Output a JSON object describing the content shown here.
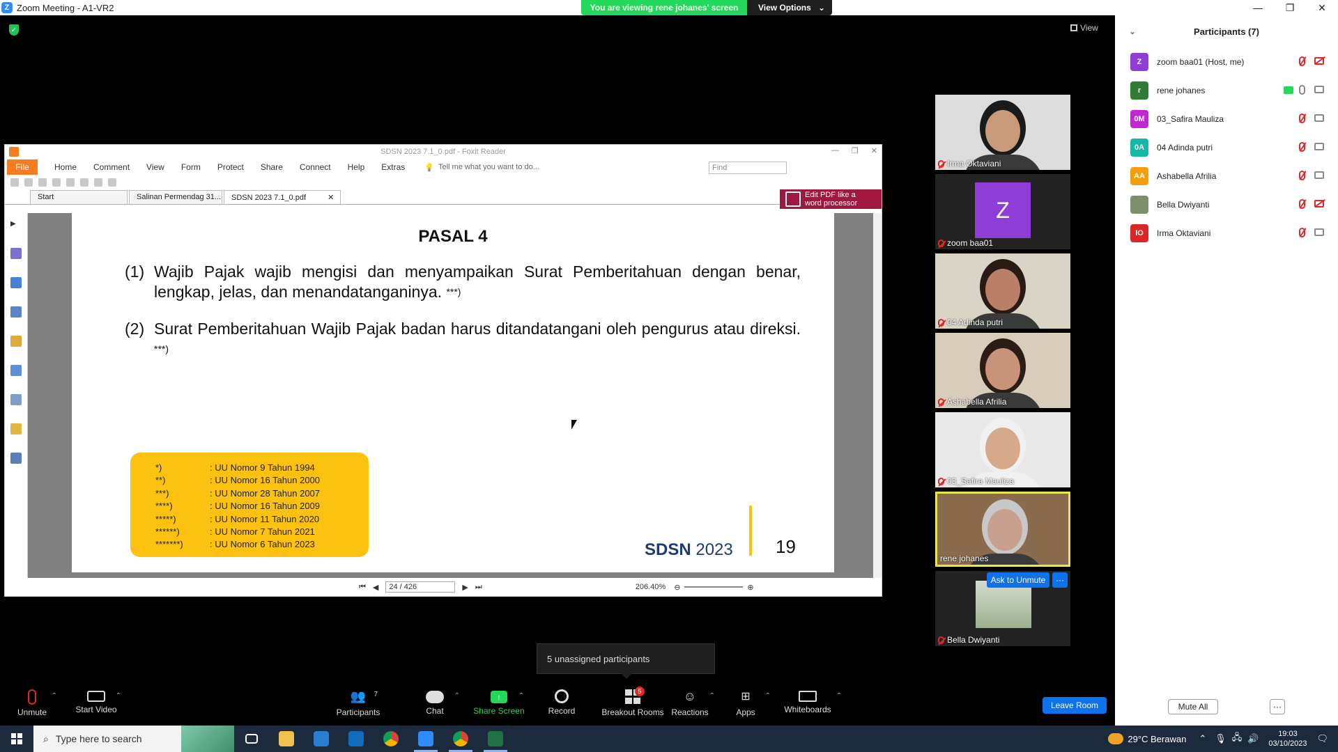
{
  "window": {
    "title": "Zoom Meeting - A1-VR2",
    "viewing_banner": "You are viewing rene johanes' screen",
    "view_options": "View Options",
    "view_label": "View"
  },
  "foxit": {
    "title": "SDSN 2023 7.1_0.pdf - Foxit Reader",
    "menu": [
      "File",
      "Home",
      "Comment",
      "View",
      "Form",
      "Protect",
      "Share",
      "Connect",
      "Help",
      "Extras"
    ],
    "tell_me": "Tell me what you want to do...",
    "find_placeholder": "Find",
    "tabs": [
      "Start",
      "Salinan Permendag 31...",
      "SDSN 2023 7.1_0.pdf"
    ],
    "edit_pdf": [
      "Edit PDF like a",
      "word processor"
    ],
    "page_nav": "24 / 426",
    "zoom": "206.40%"
  },
  "document": {
    "heading": "PASAL 4",
    "clauses": [
      {
        "num": "(1)",
        "text": "Wajib Pajak wajib mengisi dan menyampaikan Surat Pemberitahuan dengan benar, lengkap, jelas, dan menandatanganinya.",
        "sup": "***)"
      },
      {
        "num": "(2)",
        "text": "Surat Pemberitahuan Wajib Pajak badan harus ditandatangani oleh pengurus atau direksi.",
        "sup": "***)"
      }
    ],
    "legend": [
      {
        "k": "*)",
        "v": ": UU Nomor 9 Tahun 1994"
      },
      {
        "k": "**)",
        "v": ": UU Nomor 16 Tahun 2000"
      },
      {
        "k": "***)",
        "v": ": UU Nomor 28 Tahun 2007"
      },
      {
        "k": "****)",
        "v": ": UU Nomor 16 Tahun 2009"
      },
      {
        "k": "*****)",
        "v": ": UU Nomor 11 Tahun 2020"
      },
      {
        "k": "******)",
        "v": ": UU Nomor 7 Tahun 2021"
      },
      {
        "k": "*******)",
        "v": ": UU Nomor 6 Tahun 2023"
      }
    ],
    "footer_brand_bold": "SDSN",
    "footer_brand_year": " 2023",
    "page_number": "19"
  },
  "gallery": [
    {
      "name": "Irma Oktaviani",
      "type": "video",
      "skin": "#c89a7a",
      "bg": "#dcdcdc",
      "hair": "#1a1a1a"
    },
    {
      "name": "zoom baa01",
      "type": "avatar",
      "initial": "Z"
    },
    {
      "name": "04 Adinda putri",
      "type": "video",
      "skin": "#b98067",
      "bg": "#d9d4c6",
      "hair": "#2a1a14"
    },
    {
      "name": "Ashabella Afrilia",
      "type": "video",
      "skin": "#c9937a",
      "bg": "#d8cdbb",
      "hair": "#2b1c15"
    },
    {
      "name": "03_Safira Mauliza",
      "type": "video",
      "skin": "#d6a98a",
      "bg": "#e8e8e8",
      "hair": "#f0f0f0"
    },
    {
      "name": "rene johanes",
      "type": "video",
      "skin": "#c8a090",
      "bg": "#8b6b4e",
      "hair": "#c8c8c8",
      "active": true
    },
    {
      "name": "Bella Dwiyanti",
      "type": "photo"
    }
  ],
  "ask_to_unmute": "Ask to Unmute",
  "more": "···",
  "unassigned": "5 unassigned participants",
  "controls": {
    "unmute": "Unmute",
    "start_video": "Start Video",
    "participants": "Participants",
    "participants_count": "7",
    "chat": "Chat",
    "share_screen": "Share Screen",
    "record": "Record",
    "breakout_rooms": "Breakout Rooms",
    "breakout_badge": "5",
    "reactions": "Reactions",
    "apps": "Apps",
    "whiteboards": "Whiteboards",
    "leave_room": "Leave Room"
  },
  "participants": {
    "title": "Participants (7)",
    "list": [
      {
        "initials": "Z",
        "name": "zoom baa01 (Host, me)",
        "color": "#8f3cd8",
        "mic": "off",
        "cam": "off"
      },
      {
        "initials": "r",
        "name": "rene johanes",
        "color": "#2e7d32",
        "mic": "on",
        "cam": "on",
        "sharing": true
      },
      {
        "initials": "0M",
        "name": "03_Safira Mauliza",
        "color": "#c026d3",
        "mic": "off",
        "cam": "on"
      },
      {
        "initials": "0A",
        "name": "04 Adinda putri",
        "color": "#14b8a6",
        "mic": "off",
        "cam": "on"
      },
      {
        "initials": "AA",
        "name": "Ashabella Afrilia",
        "color": "#f59e0b",
        "mic": "off",
        "cam": "on"
      },
      {
        "initials": "",
        "name": "Bella Dwiyanti",
        "color": "#7c8f6a",
        "mic": "off",
        "cam": "off"
      },
      {
        "initials": "IO",
        "name": "Irma Oktaviani",
        "color": "#dc2626",
        "mic": "off",
        "cam": "on"
      }
    ],
    "mute_all": "Mute All"
  },
  "taskbar": {
    "search": "Type here to search",
    "weather": "29°C  Berawan",
    "time": "19:03",
    "date": "03/10/2023"
  }
}
